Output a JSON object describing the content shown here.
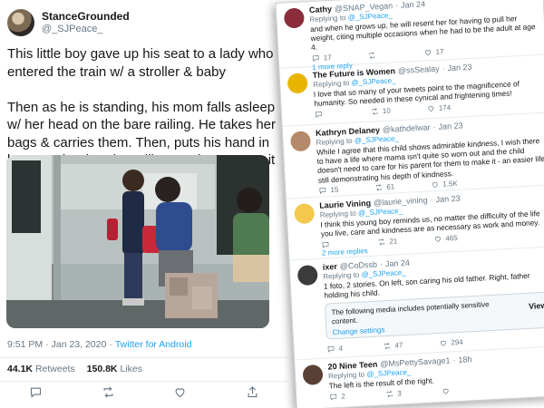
{
  "main_tweet": {
    "name": "StanceGrounded",
    "handle": "@_SJPeace_",
    "text": "This little boy gave up his seat to a lady who entered the train w/ a stroller & baby\n\nThen as he is standing, his mom falls asleep w/ her head on the bare railing. He takes her bags & carries them. Then, puts his hand in between her head & railing so she can use it as a pillow😭",
    "time": "9:51 PM",
    "date": "Jan 23, 2020",
    "source": "Twitter for Android",
    "retweets": "44.1K",
    "retweets_label": "Retweets",
    "likes": "150.8K",
    "likes_label": "Likes"
  },
  "replies": [
    {
      "name": "Cathy",
      "handle": "@SNAP_Vegan",
      "date": "Jan 24",
      "replying_label": "Replying to",
      "replying_to": "@_SJPeace_",
      "text": "and when he grows up, he will resent her for having to pull her weight, citing multiple occasions when he had to be the adult at age 4.",
      "retweets": "",
      "likes": "17",
      "replies": "17",
      "more": "1 more reply",
      "avatar_color": "#8a2c3a"
    },
    {
      "name": "The Future is Women",
      "handle": "@ssSealay",
      "date": "Jan 23",
      "replying_label": "Replying to",
      "replying_to": "@_SJPeace_",
      "text": "I love that so many of your tweets point to the magnificence of humanity. So needed in these cynical and frightening times!",
      "replies": "",
      "retweets": "10",
      "likes": "174",
      "avatar_color": "#e8b400"
    },
    {
      "name": "Kathryn Delaney",
      "handle": "@kathdelwar",
      "date": "Jan 23",
      "replying_label": "Replying to",
      "replying_to": "@_SJPeace_",
      "text": "While I agree that this child shows admirable kindness, I wish there to have a life where mama isn't quite so worn out and the child doesn't need to care for his parent for them to make it - an easier life still demonstrating his depth of kindness.",
      "replies": "15",
      "retweets": "61",
      "likes": "1.5K",
      "avatar_color": "#b48a6a"
    },
    {
      "name": "Laurie Vining",
      "handle": "@laurie_vining",
      "date": "Jan 23",
      "replying_label": "Replying to",
      "replying_to": "@_SJPeace_",
      "text": "I think this young boy reminds us, no matter the difficulty of the life you live, care and kindness are as necessary as work and money.",
      "replies": "",
      "retweets": "21",
      "likes": "465",
      "more": "2 more replies",
      "avatar_color": "#f2c94c"
    },
    {
      "name": "ixer",
      "handle": "@CoDssb",
      "date": "Jan 24",
      "replying_label": "Replying to",
      "replying_to": "@_SJPeace_",
      "text": "1 foto, 2 stories. On left, son caring his old father. Right, father holding his child.",
      "media_note": "The following media includes potentially sensitive content.",
      "media_link": "Change settings",
      "media_view": "View",
      "replies": "4",
      "retweets": "47",
      "likes": "294",
      "avatar_color": "#3b3b3b"
    },
    {
      "name": "20 Nine Teen",
      "handle": "@MsPettySavage1",
      "date": "18h",
      "replying_label": "Replying to",
      "replying_to": "@_SJPeace_",
      "text": "The left is the result of the right.",
      "replies": "2",
      "retweets": "3",
      "likes": "",
      "avatar_color": "#5a4034"
    }
  ],
  "icons": {
    "reply": "comment-bubble-icon",
    "retweet": "retweet-arrows-icon",
    "like": "heart-icon",
    "share": "share-icon"
  },
  "colors": {
    "link": "#1da1f2",
    "muted": "#657786",
    "text": "#14171a"
  }
}
